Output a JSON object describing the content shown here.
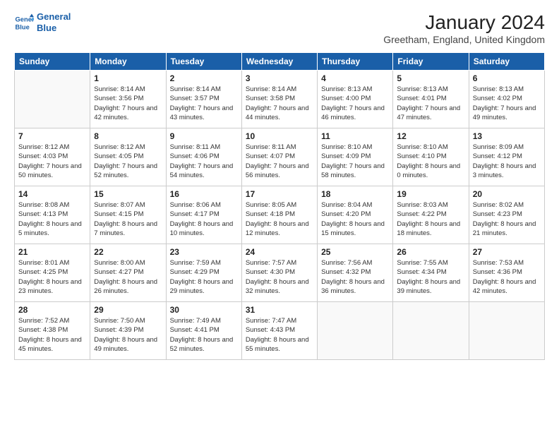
{
  "header": {
    "logo_line1": "General",
    "logo_line2": "Blue",
    "month_title": "January 2024",
    "location": "Greetham, England, United Kingdom"
  },
  "weekdays": [
    "Sunday",
    "Monday",
    "Tuesday",
    "Wednesday",
    "Thursday",
    "Friday",
    "Saturday"
  ],
  "weeks": [
    [
      {
        "day": "",
        "empty": true
      },
      {
        "day": "1",
        "sunrise": "8:14 AM",
        "sunset": "3:56 PM",
        "daylight": "7 hours and 42 minutes."
      },
      {
        "day": "2",
        "sunrise": "8:14 AM",
        "sunset": "3:57 PM",
        "daylight": "7 hours and 43 minutes."
      },
      {
        "day": "3",
        "sunrise": "8:14 AM",
        "sunset": "3:58 PM",
        "daylight": "7 hours and 44 minutes."
      },
      {
        "day": "4",
        "sunrise": "8:13 AM",
        "sunset": "4:00 PM",
        "daylight": "7 hours and 46 minutes."
      },
      {
        "day": "5",
        "sunrise": "8:13 AM",
        "sunset": "4:01 PM",
        "daylight": "7 hours and 47 minutes."
      },
      {
        "day": "6",
        "sunrise": "8:13 AM",
        "sunset": "4:02 PM",
        "daylight": "7 hours and 49 minutes."
      }
    ],
    [
      {
        "day": "7",
        "sunrise": "8:12 AM",
        "sunset": "4:03 PM",
        "daylight": "7 hours and 50 minutes."
      },
      {
        "day": "8",
        "sunrise": "8:12 AM",
        "sunset": "4:05 PM",
        "daylight": "7 hours and 52 minutes."
      },
      {
        "day": "9",
        "sunrise": "8:11 AM",
        "sunset": "4:06 PM",
        "daylight": "7 hours and 54 minutes."
      },
      {
        "day": "10",
        "sunrise": "8:11 AM",
        "sunset": "4:07 PM",
        "daylight": "7 hours and 56 minutes."
      },
      {
        "day": "11",
        "sunrise": "8:10 AM",
        "sunset": "4:09 PM",
        "daylight": "7 hours and 58 minutes."
      },
      {
        "day": "12",
        "sunrise": "8:10 AM",
        "sunset": "4:10 PM",
        "daylight": "8 hours and 0 minutes."
      },
      {
        "day": "13",
        "sunrise": "8:09 AM",
        "sunset": "4:12 PM",
        "daylight": "8 hours and 3 minutes."
      }
    ],
    [
      {
        "day": "14",
        "sunrise": "8:08 AM",
        "sunset": "4:13 PM",
        "daylight": "8 hours and 5 minutes."
      },
      {
        "day": "15",
        "sunrise": "8:07 AM",
        "sunset": "4:15 PM",
        "daylight": "8 hours and 7 minutes."
      },
      {
        "day": "16",
        "sunrise": "8:06 AM",
        "sunset": "4:17 PM",
        "daylight": "8 hours and 10 minutes."
      },
      {
        "day": "17",
        "sunrise": "8:05 AM",
        "sunset": "4:18 PM",
        "daylight": "8 hours and 12 minutes."
      },
      {
        "day": "18",
        "sunrise": "8:04 AM",
        "sunset": "4:20 PM",
        "daylight": "8 hours and 15 minutes."
      },
      {
        "day": "19",
        "sunrise": "8:03 AM",
        "sunset": "4:22 PM",
        "daylight": "8 hours and 18 minutes."
      },
      {
        "day": "20",
        "sunrise": "8:02 AM",
        "sunset": "4:23 PM",
        "daylight": "8 hours and 21 minutes."
      }
    ],
    [
      {
        "day": "21",
        "sunrise": "8:01 AM",
        "sunset": "4:25 PM",
        "daylight": "8 hours and 23 minutes."
      },
      {
        "day": "22",
        "sunrise": "8:00 AM",
        "sunset": "4:27 PM",
        "daylight": "8 hours and 26 minutes."
      },
      {
        "day": "23",
        "sunrise": "7:59 AM",
        "sunset": "4:29 PM",
        "daylight": "8 hours and 29 minutes."
      },
      {
        "day": "24",
        "sunrise": "7:57 AM",
        "sunset": "4:30 PM",
        "daylight": "8 hours and 32 minutes."
      },
      {
        "day": "25",
        "sunrise": "7:56 AM",
        "sunset": "4:32 PM",
        "daylight": "8 hours and 36 minutes."
      },
      {
        "day": "26",
        "sunrise": "7:55 AM",
        "sunset": "4:34 PM",
        "daylight": "8 hours and 39 minutes."
      },
      {
        "day": "27",
        "sunrise": "7:53 AM",
        "sunset": "4:36 PM",
        "daylight": "8 hours and 42 minutes."
      }
    ],
    [
      {
        "day": "28",
        "sunrise": "7:52 AM",
        "sunset": "4:38 PM",
        "daylight": "8 hours and 45 minutes."
      },
      {
        "day": "29",
        "sunrise": "7:50 AM",
        "sunset": "4:39 PM",
        "daylight": "8 hours and 49 minutes."
      },
      {
        "day": "30",
        "sunrise": "7:49 AM",
        "sunset": "4:41 PM",
        "daylight": "8 hours and 52 minutes."
      },
      {
        "day": "31",
        "sunrise": "7:47 AM",
        "sunset": "4:43 PM",
        "daylight": "8 hours and 55 minutes."
      },
      {
        "day": "",
        "empty": true
      },
      {
        "day": "",
        "empty": true
      },
      {
        "day": "",
        "empty": true
      }
    ]
  ],
  "labels": {
    "sunrise_prefix": "Sunrise: ",
    "sunset_prefix": "Sunset: ",
    "daylight_prefix": "Daylight: "
  }
}
